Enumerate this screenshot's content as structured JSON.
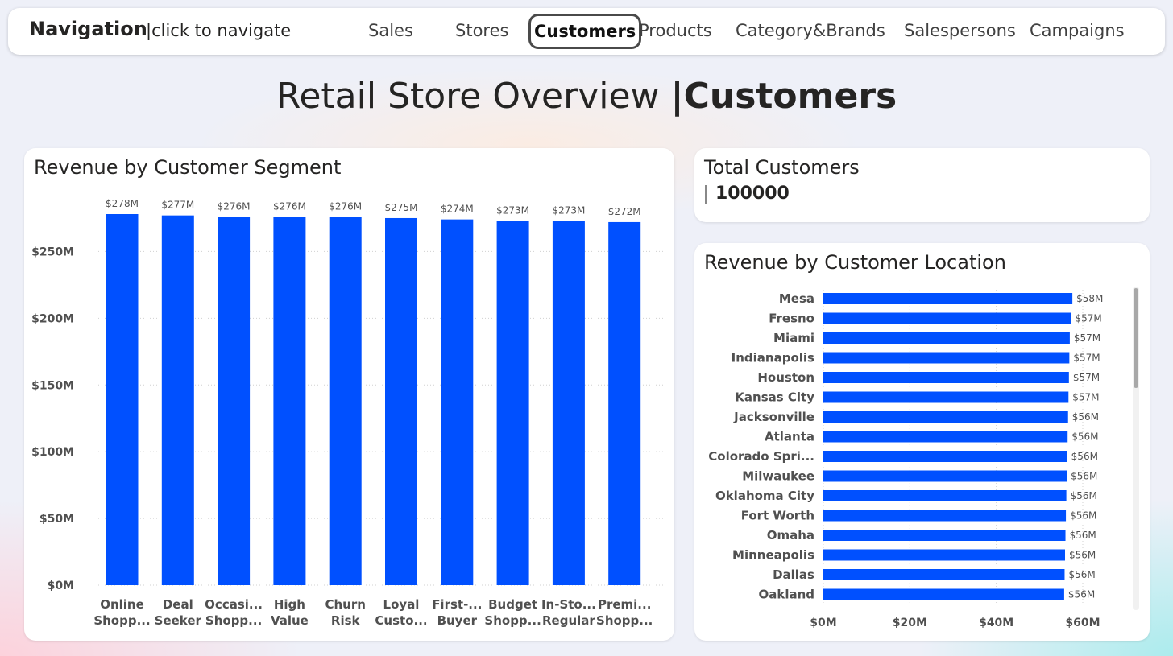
{
  "nav": {
    "title": "Navigation",
    "hint": "|click to navigate",
    "tabs": [
      {
        "label": "Sales"
      },
      {
        "label": "Stores"
      },
      {
        "label": "Customers",
        "active": true
      },
      {
        "label": "Products"
      },
      {
        "label": "Category&Brands"
      },
      {
        "label": "Salespersons"
      },
      {
        "label": "Campaigns"
      }
    ]
  },
  "page": {
    "title_prefix": "Retail Store Overview ",
    "title_section": "|Customers"
  },
  "kpi": {
    "title": "Total Customers",
    "value": "100000"
  },
  "colors": {
    "bar": "#0050ff",
    "grid": "#d0d0d0",
    "axis_text": "#505050"
  },
  "chart_data": [
    {
      "type": "bar",
      "orientation": "vertical",
      "title": "Revenue by Customer Segment",
      "categories": [
        [
          "Online",
          "Shopp..."
        ],
        [
          "Deal",
          "Seeker"
        ],
        [
          "Occasi...",
          "Shopp..."
        ],
        [
          "High",
          "Value"
        ],
        [
          "Churn",
          "Risk"
        ],
        [
          "Loyal",
          "Custo..."
        ],
        [
          "First-...",
          "Buyer"
        ],
        [
          "Budget",
          "Shopp..."
        ],
        [
          "In-Sto...",
          "Regular"
        ],
        [
          "Premi...",
          "Shopp..."
        ]
      ],
      "values": [
        278,
        277,
        276,
        276,
        276,
        275,
        274,
        273,
        273,
        272
      ],
      "data_labels": [
        "$278M",
        "$277M",
        "$276M",
        "$276M",
        "$276M",
        "$275M",
        "$274M",
        "$273M",
        "$273M",
        "$272M"
      ],
      "yticks": [
        0,
        50,
        100,
        150,
        200,
        250
      ],
      "ytick_labels": [
        "$0M",
        "$50M",
        "$100M",
        "$150M",
        "$200M",
        "$250M"
      ],
      "ylim": [
        0,
        278
      ],
      "grid": true,
      "xlabel": "",
      "ylabel": ""
    },
    {
      "type": "bar",
      "orientation": "horizontal",
      "title": "Revenue by Customer Location",
      "categories": [
        "Mesa",
        "Fresno",
        "Miami",
        "Indianapolis",
        "Houston",
        "Kansas City",
        "Jacksonville",
        "Atlanta",
        "Colorado Spri...",
        "Milwaukee",
        "Oklahoma City",
        "Fort Worth",
        "Omaha",
        "Minneapolis",
        "Dallas",
        "Oakland"
      ],
      "values": [
        57.6,
        57.3,
        57.0,
        56.9,
        56.8,
        56.7,
        56.6,
        56.5,
        56.4,
        56.3,
        56.2,
        56.1,
        56.0,
        55.9,
        55.8,
        55.7
      ],
      "data_labels": [
        "$58M",
        "$57M",
        "$57M",
        "$57M",
        "$57M",
        "$57M",
        "$56M",
        "$56M",
        "$56M",
        "$56M",
        "$56M",
        "$56M",
        "$56M",
        "$56M",
        "$56M",
        "$56M"
      ],
      "xticks": [
        0,
        20,
        40,
        60
      ],
      "xtick_labels": [
        "$0M",
        "$20M",
        "$40M",
        "$60M"
      ],
      "xlim": [
        0,
        60
      ],
      "grid": true,
      "xlabel": "",
      "ylabel": ""
    }
  ]
}
